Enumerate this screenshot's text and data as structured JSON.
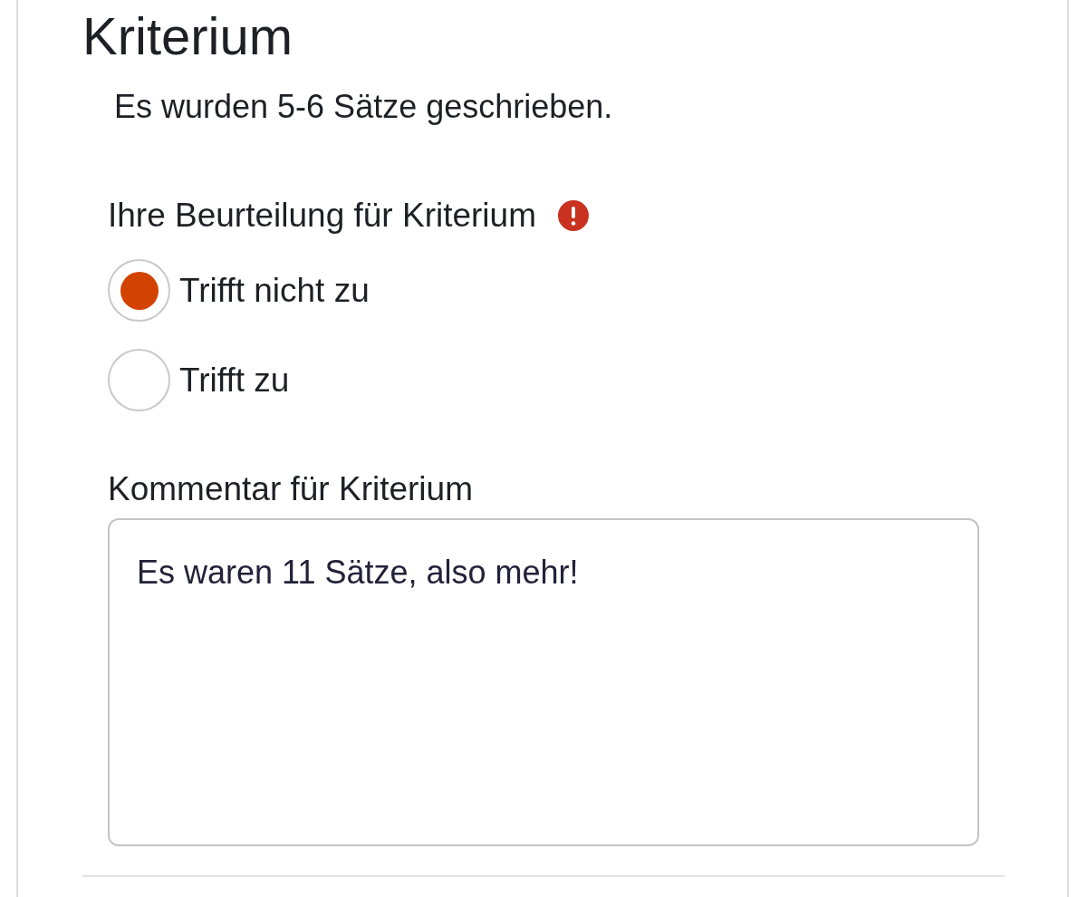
{
  "heading": "Kriterium",
  "description": "Es wurden 5-6 Sätze geschrieben.",
  "rating": {
    "label": "Ihre Beurteilung für Kriterium",
    "required_error": true,
    "options": [
      {
        "label": "Trifft nicht zu",
        "selected": true
      },
      {
        "label": "Trifft zu",
        "selected": false
      }
    ]
  },
  "comment": {
    "label": "Kommentar für Kriterium",
    "value": "Es waren 11 Sätze, also mehr!"
  }
}
